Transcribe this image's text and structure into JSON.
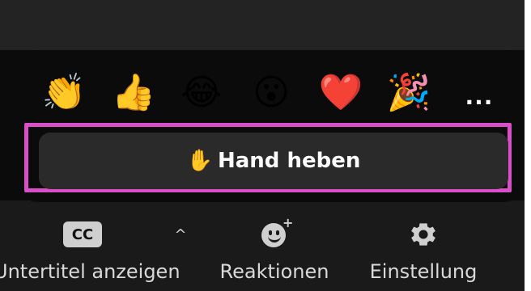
{
  "reactions_panel": {
    "emojis": [
      {
        "name": "clapping-hands",
        "glyph": "👏"
      },
      {
        "name": "thumbs-up",
        "glyph": "👍"
      },
      {
        "name": "tears-of-joy",
        "glyph": "😂"
      },
      {
        "name": "open-mouth",
        "glyph": "😮"
      },
      {
        "name": "red-heart",
        "glyph": "❤️"
      },
      {
        "name": "party-popper",
        "glyph": "🎉"
      }
    ],
    "more_label": "...",
    "raise_hand": {
      "icon": "✋",
      "label": "Hand heben"
    }
  },
  "toolbar": {
    "captions": {
      "icon_text": "CC",
      "label": "Untertitel anzeigen"
    },
    "caret": "^",
    "reactions": {
      "label": "Reaktionen"
    },
    "settings": {
      "label": "Einstellung"
    }
  },
  "colors": {
    "highlight": "#d94fc8",
    "panel": "#0b0b0b",
    "button": "#2a2a2a"
  }
}
